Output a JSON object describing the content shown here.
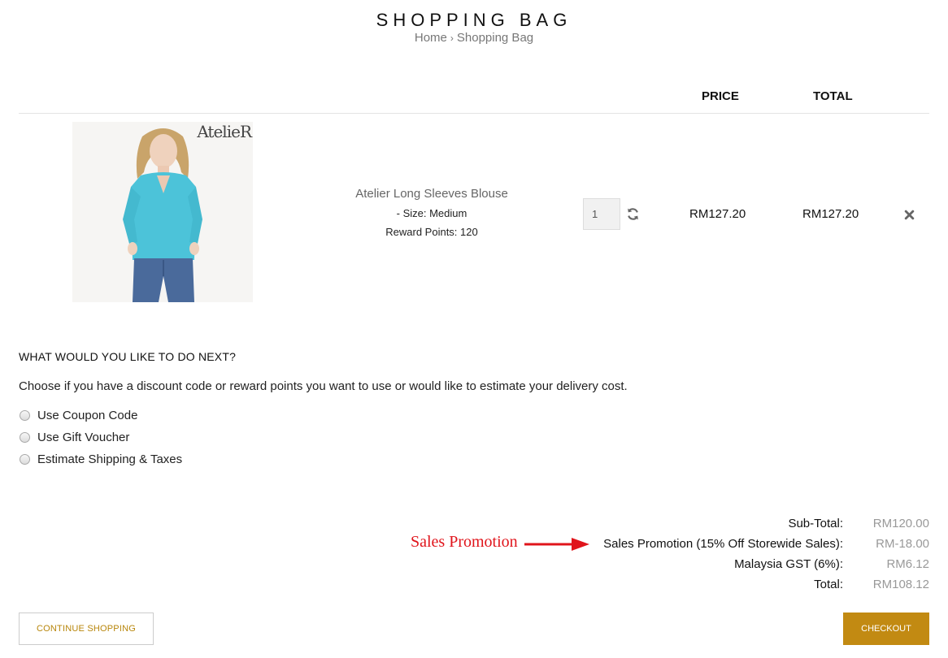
{
  "page": {
    "title": "SHOPPING BAG",
    "breadcrumb": {
      "home": "Home",
      "separator": "›",
      "current": "Shopping Bag"
    }
  },
  "cart": {
    "columns": {
      "price": "PRICE",
      "total": "TOTAL"
    },
    "items": [
      {
        "brand_mark": "AtelieR",
        "name": "Atelier Long Sleeves Blouse",
        "option": "- Size: Medium",
        "reward_points": "Reward Points: 120",
        "quantity": "1",
        "price": "RM127.20",
        "total": "RM127.20"
      }
    ]
  },
  "next": {
    "heading": "WHAT WOULD YOU LIKE TO DO NEXT?",
    "description": "Choose if you have a discount code or reward points you want to use or would like to estimate your delivery cost.",
    "options": [
      "Use Coupon Code",
      "Use Gift Voucher",
      "Estimate Shipping & Taxes"
    ]
  },
  "totals": [
    {
      "label": "Sub-Total:",
      "value": "RM120.00"
    },
    {
      "label": "Sales Promotion (15% Off Storewide Sales):",
      "value": "RM-18.00"
    },
    {
      "label": "Malaysia GST (6%):",
      "value": "RM6.12"
    },
    {
      "label": "Total:",
      "value": "RM108.12"
    }
  ],
  "annotation": {
    "text": "Sales Promotion",
    "color": "#e0141b"
  },
  "buttons": {
    "continue": "CONTINUE SHOPPING",
    "checkout": "CHECKOUT"
  },
  "colors": {
    "accent": "#c28a12",
    "muted": "#999999"
  },
  "icons": {
    "refresh": "refresh-icon",
    "remove": "close-icon",
    "radio": "radio-icon"
  }
}
